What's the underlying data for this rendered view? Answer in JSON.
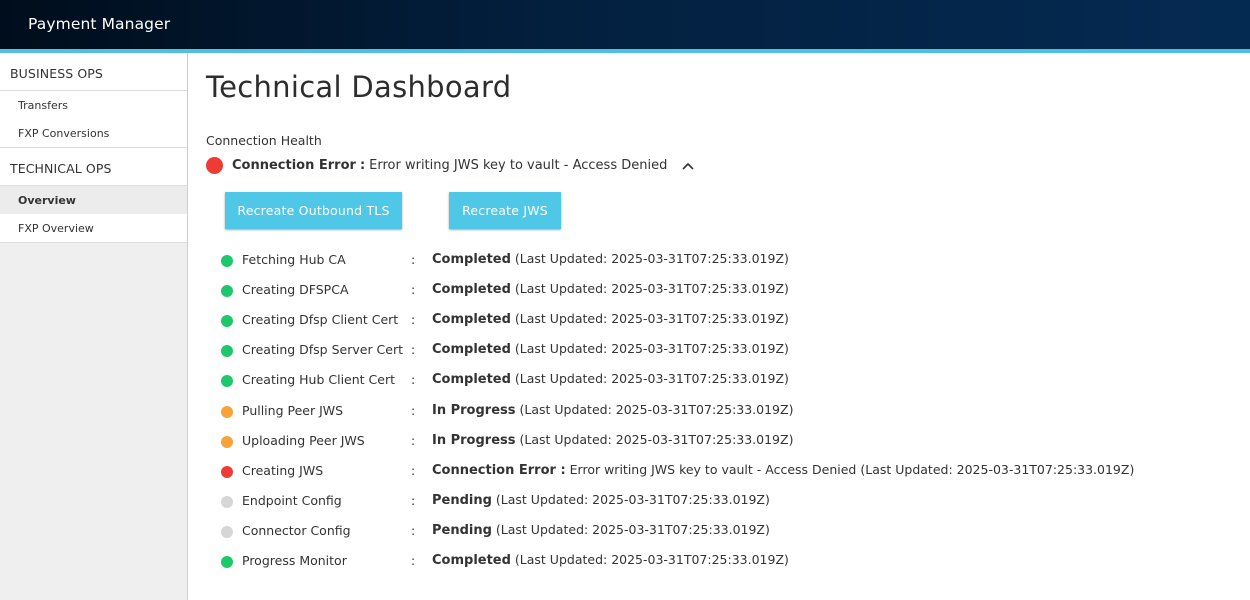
{
  "app": {
    "title": "Payment Manager"
  },
  "sidebar": {
    "groups": [
      {
        "title": "BUSINESS OPS",
        "items": [
          "Transfers",
          "FXP Conversions"
        ]
      },
      {
        "title": "TECHNICAL OPS",
        "items": [
          "Overview",
          "FXP Overview"
        ]
      }
    ],
    "active_item": "Overview"
  },
  "main": {
    "title": "Technical Dashboard",
    "health_label": "Connection Health",
    "connection": {
      "status": "Connection Error",
      "separator": ":",
      "message": "Error writing JWS key to vault - Access Denied",
      "status_color": "#ef3b35"
    },
    "buttons": {
      "recreate_tls": "Recreate Outbound TLS",
      "recreate_jws": "Recreate JWS"
    },
    "colors": {
      "completed": "#1ec86a",
      "in_progress": "#f7a23b",
      "error": "#ef3b35",
      "pending": "#d6d6d6",
      "accent": "#4fc8e8"
    },
    "steps": [
      {
        "name": "Fetching Hub CA",
        "status": "Completed",
        "message": "",
        "updated": "(Last Updated: 2025-03-31T07:25:33.019Z)",
        "state": "completed"
      },
      {
        "name": "Creating DFSPCA",
        "status": "Completed",
        "message": "",
        "updated": "(Last Updated: 2025-03-31T07:25:33.019Z)",
        "state": "completed"
      },
      {
        "name": "Creating Dfsp Client Cert",
        "status": "Completed",
        "message": "",
        "updated": "(Last Updated: 2025-03-31T07:25:33.019Z)",
        "state": "completed"
      },
      {
        "name": "Creating Dfsp Server Cert",
        "status": "Completed",
        "message": "",
        "updated": "(Last Updated: 2025-03-31T07:25:33.019Z)",
        "state": "completed"
      },
      {
        "name": "Creating Hub Client Cert",
        "status": "Completed",
        "message": "",
        "updated": "(Last Updated: 2025-03-31T07:25:33.019Z)",
        "state": "completed"
      },
      {
        "name": "Pulling Peer JWS",
        "status": "In Progress",
        "message": "",
        "updated": "(Last Updated: 2025-03-31T07:25:33.019Z)",
        "state": "in_progress"
      },
      {
        "name": "Uploading Peer JWS",
        "status": "In Progress",
        "message": "",
        "updated": "(Last Updated: 2025-03-31T07:25:33.019Z)",
        "state": "in_progress"
      },
      {
        "name": "Creating JWS",
        "status": "Connection Error :",
        "message": "Error writing JWS key to vault - Access Denied",
        "updated": "(Last Updated: 2025-03-31T07:25:33.019Z)",
        "state": "error"
      },
      {
        "name": "Endpoint Config",
        "status": "Pending",
        "message": "",
        "updated": "(Last Updated: 2025-03-31T07:25:33.019Z)",
        "state": "pending"
      },
      {
        "name": "Connector Config",
        "status": "Pending",
        "message": "",
        "updated": "(Last Updated: 2025-03-31T07:25:33.019Z)",
        "state": "pending"
      },
      {
        "name": "Progress Monitor",
        "status": "Completed",
        "message": "",
        "updated": "(Last Updated: 2025-03-31T07:25:33.019Z)",
        "state": "completed"
      }
    ]
  }
}
